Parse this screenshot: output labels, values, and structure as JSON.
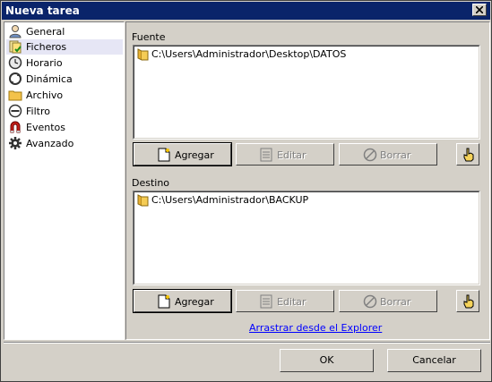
{
  "window": {
    "title": "Nueva tarea"
  },
  "nav": {
    "items": [
      {
        "label": "General",
        "icon": "general-icon"
      },
      {
        "label": "Ficheros",
        "icon": "files-icon",
        "selected": true
      },
      {
        "label": "Horario",
        "icon": "clock-icon"
      },
      {
        "label": "Dinámica",
        "icon": "dynamic-icon"
      },
      {
        "label": "Archivo",
        "icon": "folder-icon"
      },
      {
        "label": "Filtro",
        "icon": "filter-icon"
      },
      {
        "label": "Eventos",
        "icon": "magnet-icon"
      },
      {
        "label": "Avanzado",
        "icon": "gear-icon"
      }
    ]
  },
  "source": {
    "label": "Fuente",
    "paths": [
      "C:\\Users\\Administrador\\Desktop\\DATOS"
    ],
    "add_label": "Agregar",
    "edit_label": "Editar",
    "delete_label": "Borrar"
  },
  "destination": {
    "label": "Destino",
    "paths": [
      "C:\\Users\\Administrador\\BACKUP"
    ],
    "add_label": "Agregar",
    "edit_label": "Editar",
    "delete_label": "Borrar"
  },
  "drag_link": "Arrastrar desde el Explorer",
  "footer": {
    "ok_label": "OK",
    "cancel_label": "Cancelar"
  },
  "colors": {
    "titlebar": "#0a246a",
    "face": "#d4d0c8",
    "selection": "#e6e6f5",
    "link": "#0000ff"
  }
}
